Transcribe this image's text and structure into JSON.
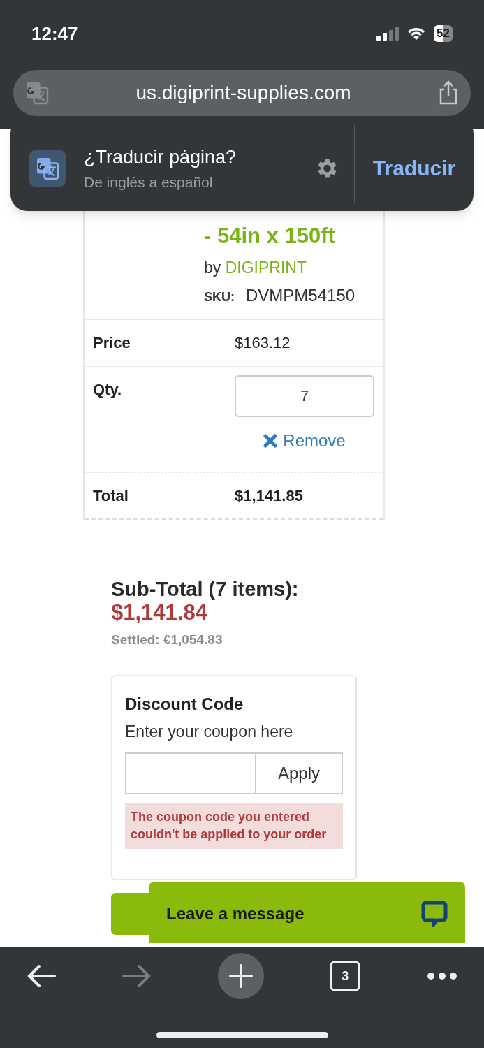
{
  "status_bar": {
    "time": "12:47",
    "battery": "52"
  },
  "address_bar": {
    "url": "us.digiprint-supplies.com"
  },
  "translate_banner": {
    "title": "¿Traducir página?",
    "subtitle": "De inglés a español",
    "action": "Traducir"
  },
  "cart_item": {
    "title": "- 54in x 150ft",
    "by": "by",
    "brand": "DIGIPRINT",
    "sku_label": "SKU:",
    "sku": "DVMPM54150",
    "rows": [
      {
        "kind": "price",
        "label": "Price",
        "value": "$163.12"
      },
      {
        "kind": "qty",
        "label": "Qty.",
        "value": "7",
        "remove": "Remove"
      },
      {
        "kind": "total",
        "label": "Total",
        "value": "$1,141.85"
      }
    ]
  },
  "summary": {
    "subtotal_label": "Sub-Total (7 items):",
    "subtotal": "$1,141.84",
    "settled": "Settled: €1,054.83"
  },
  "discount": {
    "title": "Discount Code",
    "hint": "Enter your coupon here",
    "button": "Apply",
    "error": "The coupon code you entered couldn't be applied to your order"
  },
  "chat_widget": {
    "label": "Leave a message"
  },
  "toolbar": {
    "tabs_count": "3",
    "forward_disabled": true
  }
}
